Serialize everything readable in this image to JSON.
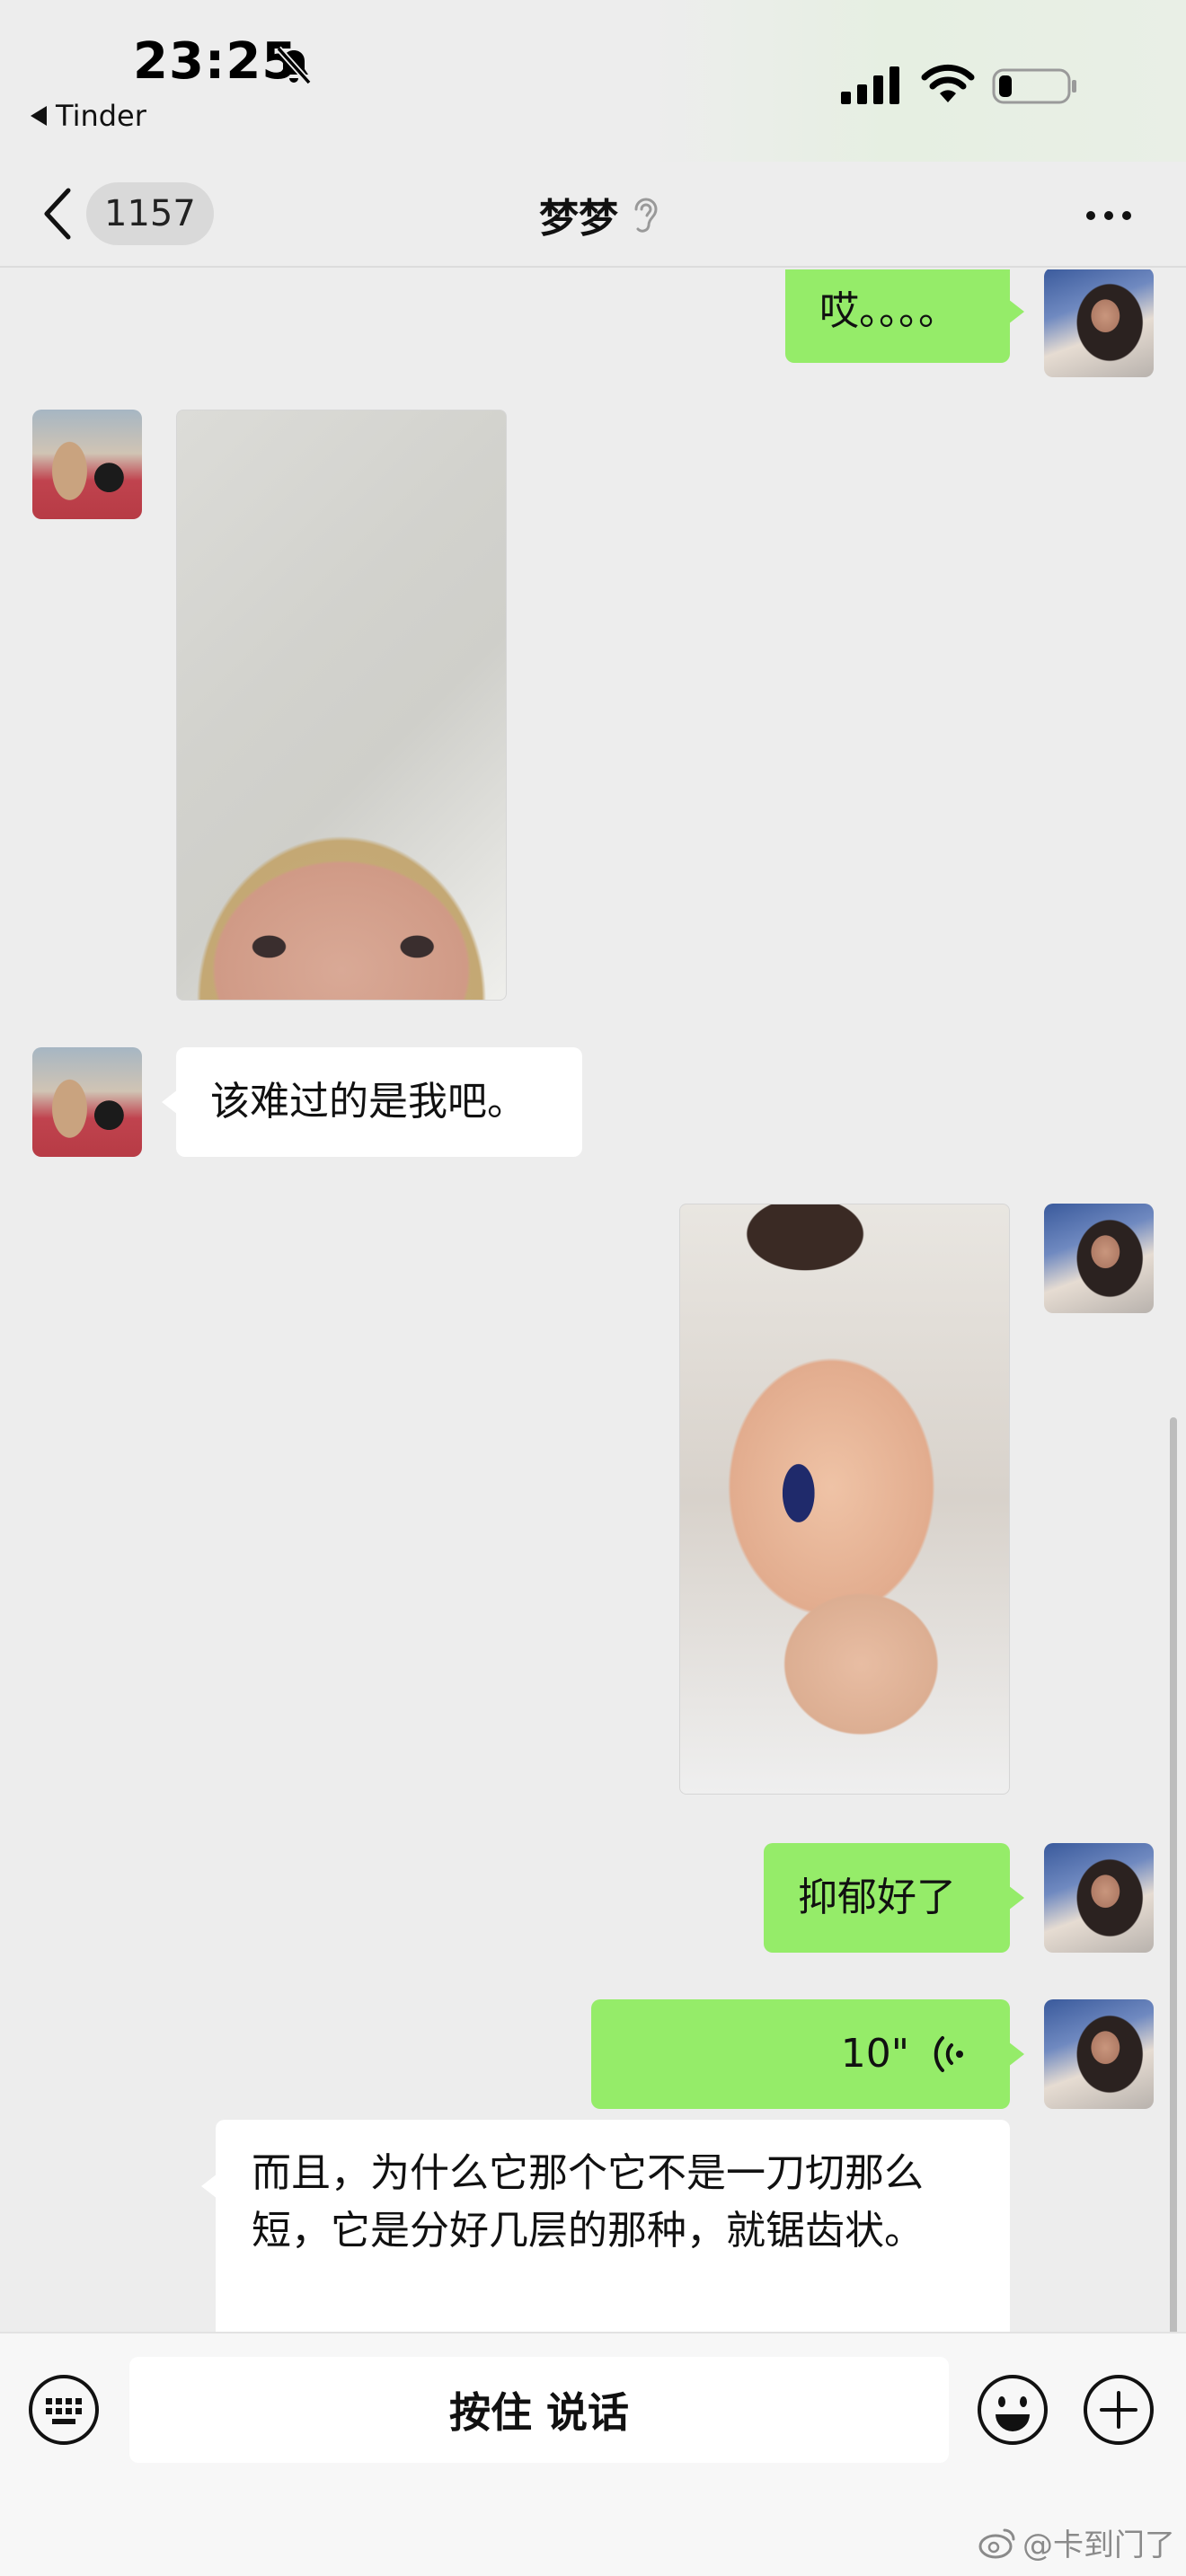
{
  "status_bar": {
    "time": "23:25",
    "back_app": "Tinder",
    "icons": [
      "bell-off-icon",
      "cellular-signal-icon",
      "wifi-icon",
      "battery-icon"
    ],
    "battery_level": 0.2
  },
  "nav": {
    "unread_count": "1157",
    "title": "梦梦",
    "icons": [
      "chevron-left-icon",
      "ear-icon",
      "more-icon"
    ]
  },
  "messages": [
    {
      "sender": "me",
      "type": "text",
      "text": "哎。。。。"
    },
    {
      "sender": "her",
      "type": "image"
    },
    {
      "sender": "her",
      "type": "text",
      "text": "该难过的是我吧。"
    },
    {
      "sender": "me",
      "type": "image"
    },
    {
      "sender": "me",
      "type": "text",
      "text": "抑郁好了"
    },
    {
      "sender": "me",
      "type": "voice",
      "duration": "10\""
    },
    {
      "sender": "me",
      "type": "voice-transcript",
      "text": "而且，为什么它那个它不是一刀切那么短，它是分好几层的那种，就锯齿状。"
    }
  ],
  "input_bar": {
    "hold_to_talk": "按住 说话",
    "icons": [
      "keyboard-icon",
      "emoji-icon",
      "plus-icon"
    ]
  },
  "watermark": "@卡到门了",
  "colors": {
    "background": "#ededed",
    "outgoing_bubble": "#95ec69",
    "incoming_bubble": "#ffffff"
  }
}
